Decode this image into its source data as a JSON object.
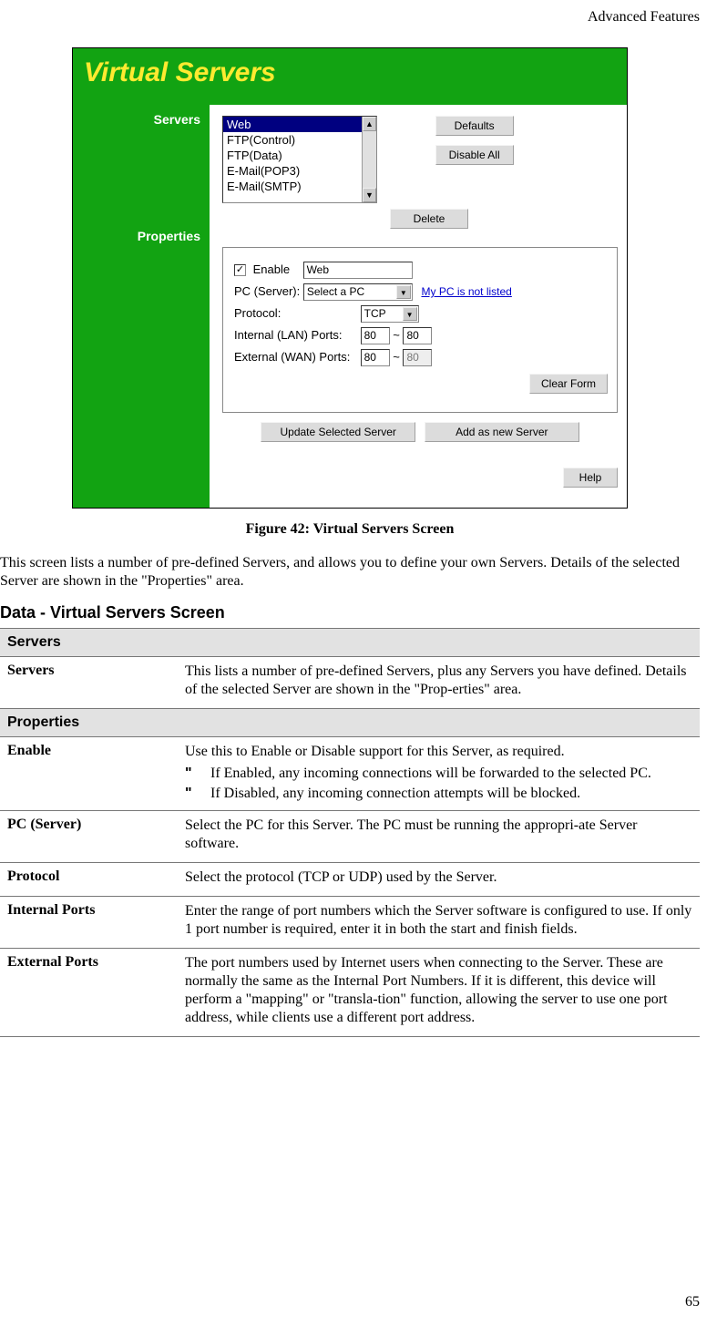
{
  "running_head": "Advanced Features",
  "page_number": "65",
  "figure": {
    "banner_title": "Virtual Servers",
    "left_labels": {
      "servers": "Servers",
      "properties": "Properties"
    },
    "server_list": [
      "Web",
      "FTP(Control)",
      "FTP(Data)",
      "E-Mail(POP3)",
      "E-Mail(SMTP)"
    ],
    "server_list_selected_index": 0,
    "buttons": {
      "defaults": "Defaults",
      "disable_all": "Disable All",
      "delete": "Delete",
      "clear_form": "Clear Form",
      "update": "Update Selected Server",
      "add_new": "Add as new Server",
      "help": "Help"
    },
    "properties": {
      "enable_label": "Enable",
      "enable_checked": true,
      "name_value": "Web",
      "pc_label": "PC (Server):",
      "pc_value": "Select a PC",
      "pc_link": "My PC is not listed",
      "protocol_label": "Protocol:",
      "protocol_value": "TCP",
      "lan_label": "Internal (LAN) Ports:",
      "lan_from": "80",
      "lan_to": "80",
      "wan_label": "External (WAN) Ports:",
      "wan_from": "80",
      "wan_to": "80",
      "tilde": "~"
    },
    "caption": "Figure 42: Virtual Servers Screen"
  },
  "intro_paragraph": "This screen lists a number of pre-defined Servers, and allows you to define your own Servers. Details of the selected Server are shown in the \"Properties\" area.",
  "section_heading": "Data - Virtual Servers Screen",
  "table": {
    "section1": "Servers",
    "row_servers": {
      "key": "Servers",
      "text": "This lists a number of pre-defined Servers, plus any Servers you have defined. Details of the selected Server are shown in the \"Prop-erties\" area."
    },
    "section2": "Properties",
    "row_enable": {
      "key": "Enable",
      "lead": "Use this to Enable or Disable support for this Server, as required.",
      "bullets": [
        "If Enabled, any incoming connections will be forwarded to the selected PC.",
        "If Disabled, any incoming connection attempts will be blocked."
      ]
    },
    "row_pc": {
      "key": "PC (Server)",
      "text": "Select the PC for this Server. The PC must be running the appropri-ate Server software."
    },
    "row_protocol": {
      "key": "Protocol",
      "text": "Select the protocol (TCP or UDP) used by the Server."
    },
    "row_internal": {
      "key": "Internal Ports",
      "text": "Enter the range of port numbers which the Server software is configured to use. If only 1 port number is required, enter it in both the start and finish fields."
    },
    "row_external": {
      "key": "External Ports",
      "text": "The port numbers used by Internet users when connecting to the Server. These are normally the same as the Internal Port Numbers. If it is different, this device will perform a \"mapping\" or \"transla-tion\" function, allowing the server to use one port address, while clients use a different port address."
    }
  }
}
